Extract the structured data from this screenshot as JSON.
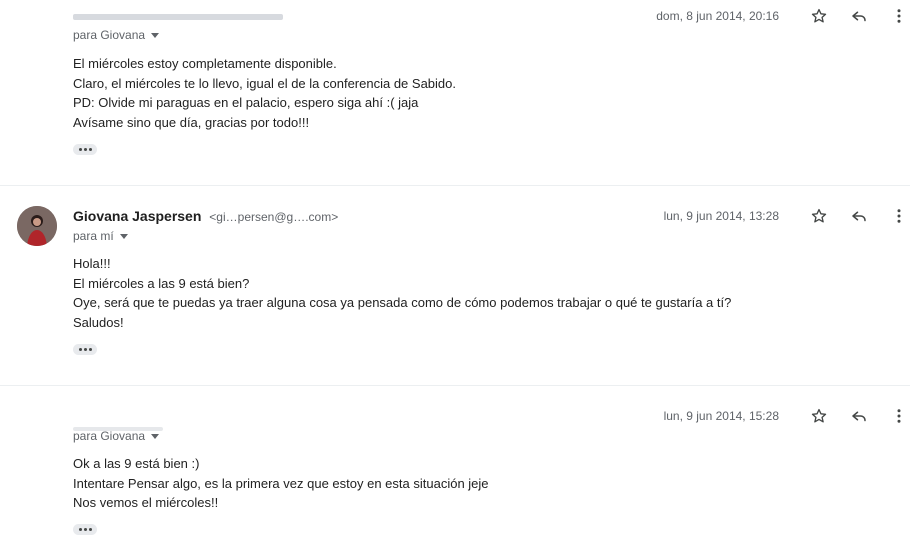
{
  "messages": [
    {
      "sender_name": "",
      "sender_email": "",
      "recipient": "para Giovana",
      "date": "dom, 8 jun 2014, 20:16",
      "body": [
        "El miércoles estoy completamente disponible.",
        "Claro, el miércoles te lo llevo, igual el de la conferencia de Sabido.",
        "PD: Olvide mi paraguas en el palacio, espero siga ahí :( jaja",
        "Avísame sino que día, gracias por todo!!!"
      ]
    },
    {
      "sender_name": "Giovana Jaspersen",
      "sender_email": "<gi…persen@g….com>",
      "recipient": "para mí",
      "date": "lun, 9 jun 2014, 13:28",
      "body": [
        "Hola!!!",
        "El miércoles a las 9 está bien?",
        "Oye, será que te puedas ya traer alguna cosa ya pensada como de cómo podemos trabajar o qué te gustaría a tí?",
        "Saludos!"
      ]
    },
    {
      "sender_name": "",
      "sender_email": "",
      "recipient": "para Giovana",
      "date": "lun, 9 jun 2014, 15:28",
      "body": [
        "Ok a las 9 está bien :)",
        "Intentare Pensar algo, es la primera vez que estoy en esta situación jeje",
        "Nos vemos el miércoles!!"
      ]
    }
  ],
  "icons": {
    "star": "star-icon",
    "reply": "reply-icon",
    "more": "more-vert-icon",
    "expand": "more-horiz-icon"
  },
  "colors": {
    "text": "#222222",
    "muted": "#5f6368",
    "divider": "#eceff1"
  }
}
